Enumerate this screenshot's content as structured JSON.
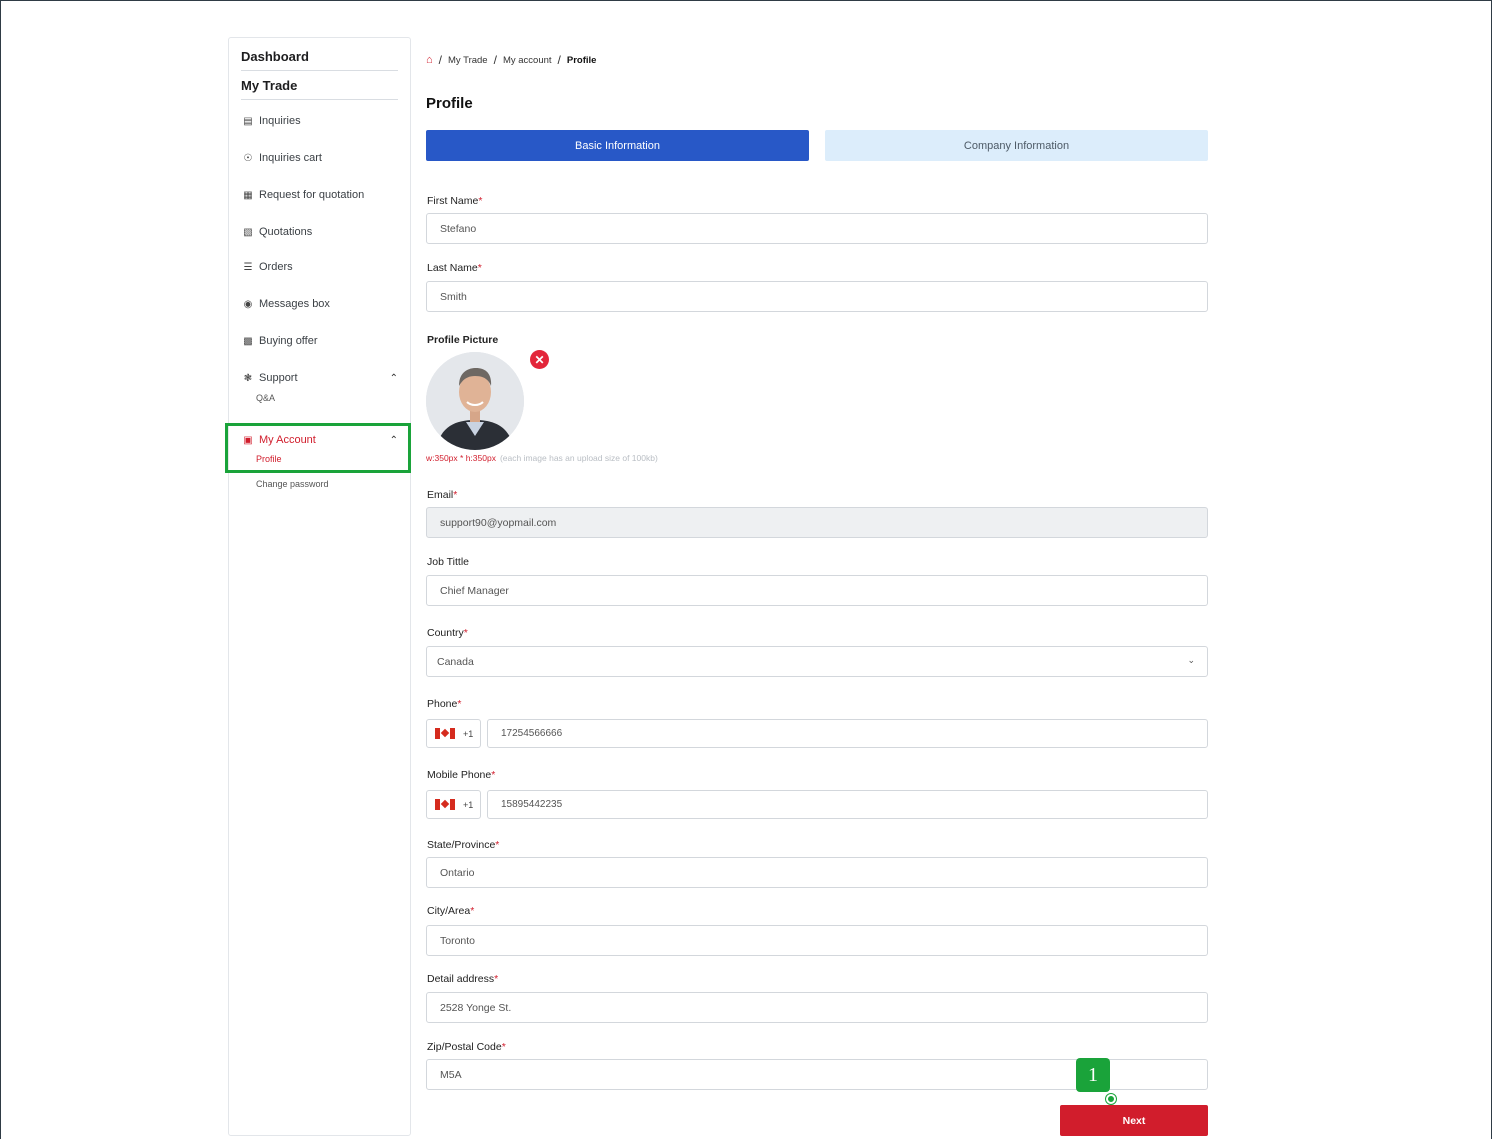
{
  "sidebar": {
    "dashboard": "Dashboard",
    "my_trade": "My Trade",
    "items": [
      {
        "label": "Inquiries",
        "icon": "inquiries-icon"
      },
      {
        "label": "Inquiries cart",
        "icon": "cart-icon"
      },
      {
        "label": "Request for quotation",
        "icon": "rfq-icon"
      },
      {
        "label": "Quotations",
        "icon": "quotations-icon"
      },
      {
        "label": "Orders",
        "icon": "orders-icon"
      },
      {
        "label": "Messages box",
        "icon": "messages-icon"
      },
      {
        "label": "Buying offer",
        "icon": "buying-offer-icon"
      },
      {
        "label": "Support",
        "icon": "support-icon"
      },
      {
        "label": "My Account",
        "icon": "account-icon"
      }
    ],
    "support_sub": "Q&A",
    "account_sub": [
      "Profile",
      "Change password"
    ]
  },
  "breadcrumb": {
    "my_trade": "My Trade",
    "my_account": "My account",
    "current": "Profile",
    "sep": "/"
  },
  "page": {
    "title": "Profile"
  },
  "tabs": {
    "basic": "Basic Information",
    "company": "Company Information"
  },
  "form": {
    "first_name": {
      "label": "First Name",
      "value": "Stefano"
    },
    "last_name": {
      "label": "Last Name",
      "value": "Smith"
    },
    "profile_picture": {
      "label": "Profile Picture",
      "size": "w:350px * h:350px",
      "hint": "(each image has an upload size of 100kb)"
    },
    "email": {
      "label": "Email",
      "value": "support90@yopmail.com"
    },
    "job_title": {
      "label": "Job Tittle",
      "value": "Chief Manager"
    },
    "country": {
      "label": "Country",
      "value": "Canada"
    },
    "phone": {
      "label": "Phone",
      "code": "+1",
      "value": "17254566666"
    },
    "mobile": {
      "label": "Mobile Phone",
      "code": "+1",
      "value": "15895442235"
    },
    "state": {
      "label": "State/Province",
      "value": "Ontario"
    },
    "city": {
      "label": "City/Area",
      "value": "Toronto"
    },
    "address": {
      "label": "Detail address",
      "value": "2528 Yonge St."
    },
    "zip": {
      "label": "Zip/Postal Code",
      "value": "M5A"
    },
    "required_mark": "*"
  },
  "actions": {
    "next": "Next"
  },
  "annotation": {
    "step": "1"
  },
  "colors": {
    "primary": "#2858c7",
    "accent": "#d11d2c",
    "highlight": "#1aa33a"
  }
}
